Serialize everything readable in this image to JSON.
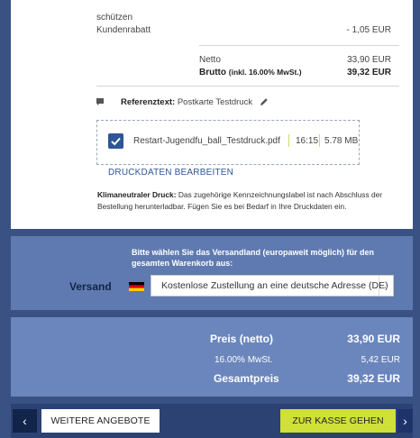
{
  "summary": {
    "schuetzen_label": "schützen",
    "discount_label": "Kundenrabatt",
    "discount_value": "- 1,05 EUR",
    "netto_label": "Netto",
    "netto_value": "33,90 EUR",
    "brutto_label": "Brutto",
    "brutto_note": "(inkl. 16.00% MwSt.)",
    "brutto_value": "39,32 EUR"
  },
  "reference": {
    "label": "Referenztext:",
    "value": "Postkarte Testdruck"
  },
  "file": {
    "name": "Restart-Jugendfu_ball_Testdruck.pdf",
    "time": "16:15",
    "size": "5.78 MB"
  },
  "edit_link": "DRUCKDATEN BEARBEITEN",
  "klima": {
    "title": "Klimaneutraler Druck:",
    "text": "Das zugehörige Kennzeichnungslabel ist nach Abschluss der Bestellung herunterladbar. Fügen Sie es bei Bedarf in Ihre Druckdaten ein."
  },
  "shipping": {
    "hint": "Bitte wählen Sie das Versandland (europaweit möglich) für den gesamten Warenkorb aus:",
    "label": "Versand",
    "selected": "Kostenlose Zustellung an eine deutsche Adresse (DE)"
  },
  "prices": {
    "netto_label": "Preis (netto)",
    "netto_value": "33,90 EUR",
    "tax_label": "16.00% MwSt.",
    "tax_value": "5,42 EUR",
    "total_label": "Gesamtpreis",
    "total_value": "39,32 EUR"
  },
  "nav": {
    "back_glyph": "‹",
    "more_label": "WEITERE ANGEBOTE",
    "checkout_label": "ZUR KASSE GEHEN",
    "next_glyph": "›"
  },
  "colors": {
    "frame": "#3a5283",
    "accent": "#2e5597",
    "checkout": "#cfe038",
    "price_band": "#6b86bd"
  }
}
